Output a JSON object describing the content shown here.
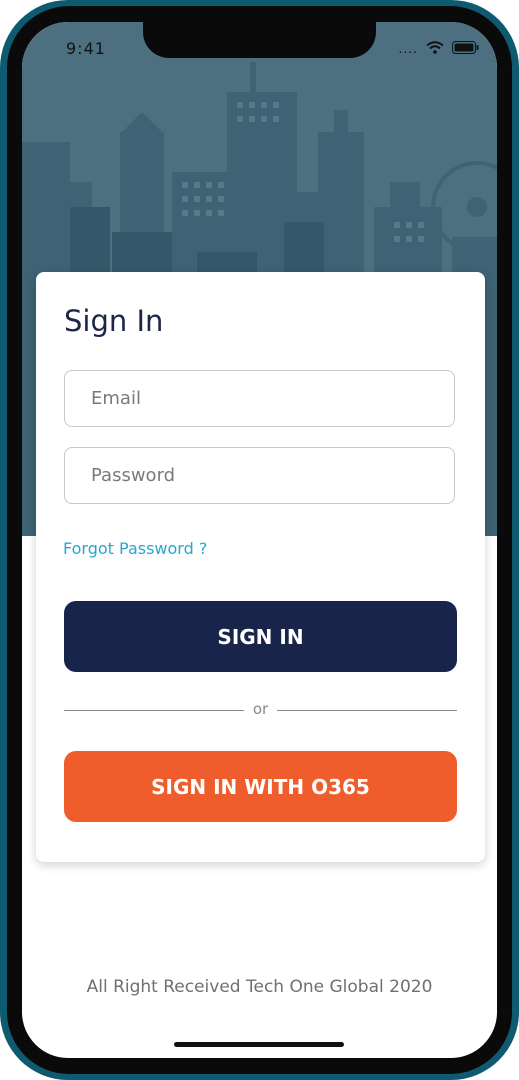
{
  "status_bar": {
    "time": "9:41",
    "signal_dots": "....",
    "wifi_icon": "wifi-icon",
    "battery_icon": "battery-icon"
  },
  "hero": {
    "background_color": "#4d7080",
    "skyline_color": "#3c5f70",
    "illustration": "city-skyline"
  },
  "card": {
    "title": "Sign In",
    "email": {
      "placeholder": "Email",
      "value": ""
    },
    "password": {
      "placeholder": "Password",
      "value": ""
    },
    "forgot_link": "Forgot Password ?",
    "signin_button": "SIGN IN",
    "divider_text": "or",
    "o365_button": "SIGN IN WITH O365"
  },
  "footer": {
    "text": "All Right Received Tech One Global 2020"
  },
  "colors": {
    "frame": "#0e5a70",
    "primary_button": "#18244a",
    "o365_button": "#f05d2c",
    "link": "#2aa6cc",
    "title": "#1c2748"
  }
}
